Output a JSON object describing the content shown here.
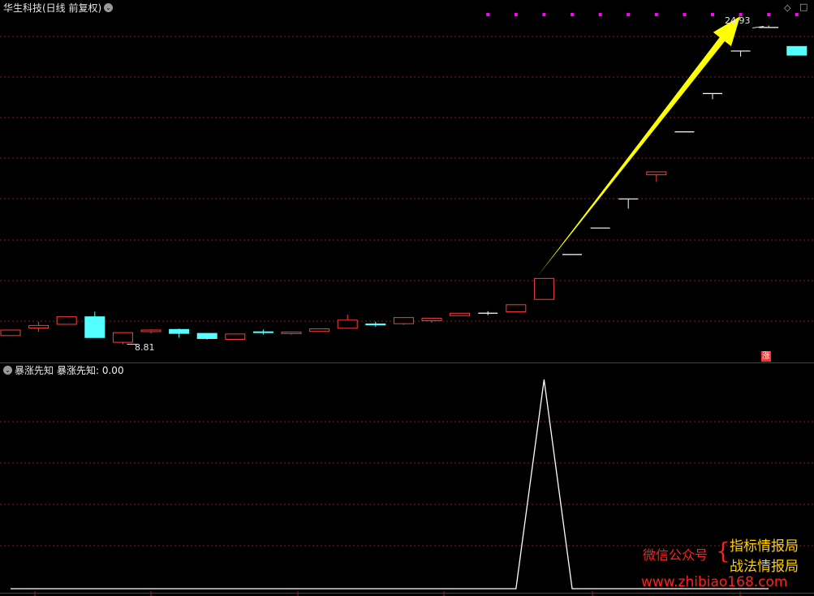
{
  "header": {
    "title": "华生科技(日线 前复权)",
    "indicator_name": "暴涨先知",
    "indicator_readout": "暴涨先知: 0.00"
  },
  "toolbar": {
    "diamond": "◇",
    "square": "□"
  },
  "limit_up_badge": "涨",
  "colors": {
    "up": "#ff3b3b",
    "down": "#54ffff",
    "neutral": "#ffffff",
    "grid": "#8b1a1a",
    "marker": "#ff00ff",
    "arrow": "#ffff00",
    "line": "#ffffff"
  },
  "chart_data": [
    {
      "type": "candlestick",
      "title": "华生科技(日线 前复权)",
      "annotations": {
        "low_label": "8.81",
        "high_label": "24.93"
      },
      "candles": [
        {
          "o": 9.25,
          "c": 9.53,
          "h": 9.53,
          "l": 9.25
        },
        {
          "o": 9.63,
          "c": 9.76,
          "h": 9.94,
          "l": 9.44
        },
        {
          "o": 9.82,
          "c": 10.2,
          "h": 10.2,
          "l": 9.82
        },
        {
          "o": 10.2,
          "c": 9.15,
          "h": 10.46,
          "l": 9.15
        },
        {
          "o": 8.91,
          "c": 9.4,
          "h": 9.4,
          "l": 8.81
        },
        {
          "o": 9.45,
          "c": 9.53,
          "h": 9.57,
          "l": 9.36
        },
        {
          "o": 9.56,
          "c": 9.36,
          "h": 9.6,
          "l": 9.14
        },
        {
          "o": 9.36,
          "c": 9.1,
          "h": 9.36,
          "l": 9.05
        },
        {
          "o": 9.06,
          "c": 9.33,
          "h": 9.33,
          "l": 9.06
        },
        {
          "o": 9.44,
          "c": 9.4,
          "h": 9.56,
          "l": 9.3
        },
        {
          "o": 9.35,
          "c": 9.43,
          "h": 9.43,
          "l": 9.3
        },
        {
          "o": 9.46,
          "c": 9.59,
          "h": 9.59,
          "l": 9.46
        },
        {
          "o": 9.62,
          "c": 10.03,
          "h": 10.31,
          "l": 9.62
        },
        {
          "o": 9.84,
          "c": 9.79,
          "h": 9.95,
          "l": 9.7
        },
        {
          "o": 9.85,
          "c": 10.16,
          "h": 10.16,
          "l": 9.79
        },
        {
          "o": 10.0,
          "c": 10.13,
          "h": 10.13,
          "l": 9.9
        },
        {
          "o": 10.26,
          "c": 10.38,
          "h": 10.38,
          "l": 10.26
        },
        {
          "o": 10.38,
          "c": 10.38,
          "h": 10.48,
          "l": 10.28
        },
        {
          "o": 10.45,
          "c": 10.81,
          "h": 10.81,
          "l": 10.45
        },
        {
          "o": 11.08,
          "c": 12.14,
          "h": 12.14,
          "l": 11.08
        },
        {
          "o": 13.35,
          "c": 13.35,
          "h": 13.35,
          "l": 13.35
        },
        {
          "o": 14.69,
          "c": 14.69,
          "h": 14.69,
          "l": 14.69
        },
        {
          "o": 16.16,
          "c": 16.16,
          "h": 16.16,
          "l": 15.67
        },
        {
          "o": 17.38,
          "c": 17.53,
          "h": 17.53,
          "l": 17.02
        },
        {
          "o": 19.55,
          "c": 19.55,
          "h": 19.55,
          "l": 19.55
        },
        {
          "o": 21.49,
          "c": 21.49,
          "h": 21.49,
          "l": 21.2
        },
        {
          "o": 23.64,
          "c": 23.64,
          "h": 23.64,
          "l": 23.36
        },
        {
          "o": 24.83,
          "c": 24.83,
          "h": 24.93,
          "l": 24.83
        },
        {
          "o": 23.87,
          "c": 23.43,
          "h": 23.87,
          "l": 23.43
        }
      ],
      "signal_markers_index": [
        17,
        18,
        19,
        20,
        21,
        22,
        23,
        24,
        25,
        26,
        27,
        28
      ]
    },
    {
      "type": "line",
      "title": "暴涨先知",
      "values": [
        0,
        0,
        0,
        0,
        0,
        0,
        0,
        0,
        0,
        0,
        0,
        0,
        0,
        0,
        0,
        0,
        0,
        0,
        0,
        1,
        0,
        0,
        0,
        0,
        0,
        0,
        0,
        0
      ]
    }
  ],
  "watermark": {
    "wechat_label": "微信公众号",
    "brace": "{",
    "line1": "指标情报局",
    "line2": "战法情报局",
    "url": "www.zhibiao168.com"
  }
}
